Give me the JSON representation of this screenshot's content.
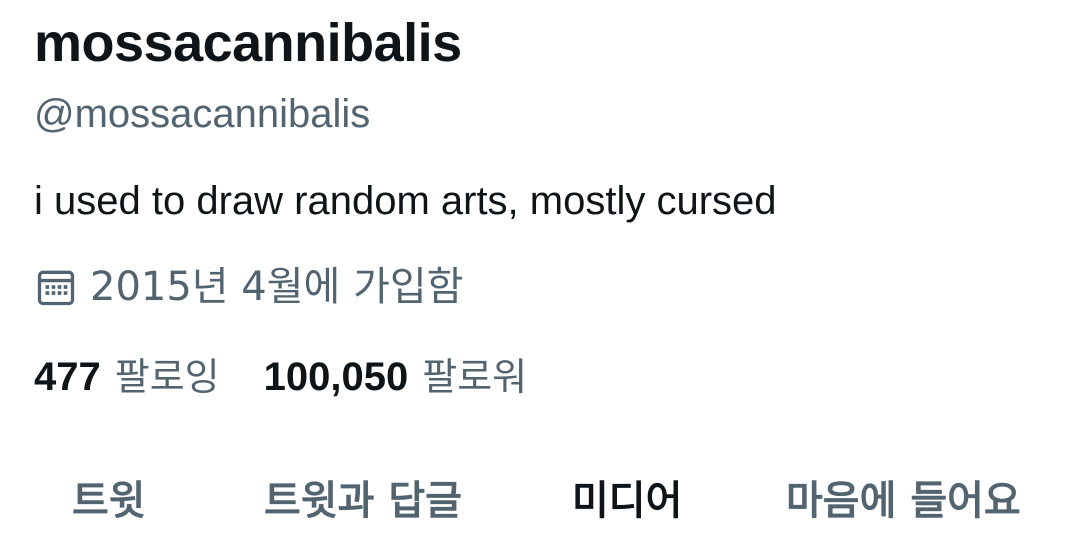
{
  "profile": {
    "display_name": "mossacannibalis",
    "handle": "@mossacannibalis",
    "bio": "i used to draw random arts, mostly cursed",
    "joined": {
      "icon": "calendar-icon",
      "text": "2015년 4월에 가입함"
    },
    "following": {
      "count": "477",
      "label": "팔로잉"
    },
    "followers": {
      "count": "100,050",
      "label": "팔로워"
    }
  },
  "tabs": [
    {
      "label": "트윗",
      "active": false
    },
    {
      "label": "트윗과 답글",
      "active": false
    },
    {
      "label": "미디어",
      "active": true
    },
    {
      "label": "마음에 들어요",
      "active": false
    }
  ],
  "colors": {
    "primary_text": "#0f1419",
    "secondary_text": "#536471",
    "background": "#ffffff"
  }
}
